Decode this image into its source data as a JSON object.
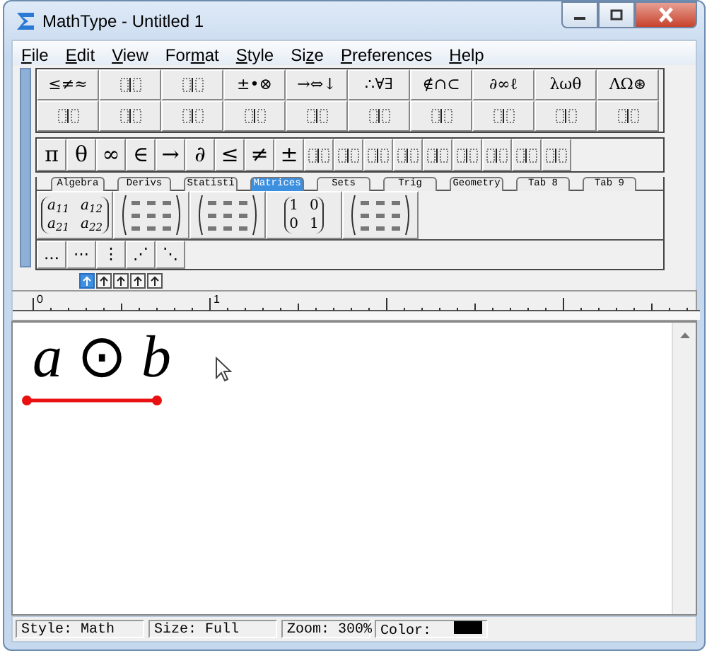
{
  "window": {
    "title": "MathType - Untitled 1"
  },
  "menu": [
    {
      "key": "F",
      "after": "ile"
    },
    {
      "key": "E",
      "after": "dit"
    },
    {
      "key": "V",
      "after": "iew"
    },
    {
      "before": "For",
      "key": "m",
      "after": "at"
    },
    {
      "key": "S",
      "after": "tyle"
    },
    {
      "before": "Si",
      "key": "z",
      "after": "e"
    },
    {
      "key": "P",
      "after": "references"
    },
    {
      "key": "H",
      "after": "elp"
    }
  ],
  "palette_rows": [
    [
      {
        "kind": "symbols",
        "label": "≤≠≈"
      },
      {
        "kind": "template"
      },
      {
        "kind": "template"
      },
      {
        "kind": "symbols",
        "label": "±•⊗"
      },
      {
        "kind": "symbols",
        "label": "→⇔↓"
      },
      {
        "kind": "symbols",
        "label": "∴∀∃"
      },
      {
        "kind": "symbols",
        "label": "∉∩⊂"
      },
      {
        "kind": "symbols",
        "label": "∂∞ℓ"
      },
      {
        "kind": "symbols",
        "label": "λωθ"
      },
      {
        "kind": "symbols",
        "label": "ΛΩ⊛"
      }
    ],
    [
      {
        "kind": "template"
      },
      {
        "kind": "template"
      },
      {
        "kind": "template"
      },
      {
        "kind": "template"
      },
      {
        "kind": "template"
      },
      {
        "kind": "template"
      },
      {
        "kind": "template"
      },
      {
        "kind": "template"
      },
      {
        "kind": "template"
      },
      {
        "kind": "template"
      }
    ]
  ],
  "small_bar": [
    {
      "kind": "symbols",
      "label": "π"
    },
    {
      "kind": "symbols",
      "label": "θ"
    },
    {
      "kind": "symbols",
      "label": "∞"
    },
    {
      "kind": "symbols",
      "label": "∈"
    },
    {
      "kind": "symbols",
      "label": "→"
    },
    {
      "kind": "symbols",
      "label": "∂"
    },
    {
      "kind": "symbols",
      "label": "≤"
    },
    {
      "kind": "symbols",
      "label": "≠"
    },
    {
      "kind": "symbols",
      "label": "±"
    },
    {
      "kind": "template"
    },
    {
      "kind": "template"
    },
    {
      "kind": "template"
    },
    {
      "kind": "template"
    },
    {
      "kind": "template"
    },
    {
      "kind": "template"
    },
    {
      "kind": "template"
    },
    {
      "kind": "template"
    },
    {
      "kind": "template"
    }
  ],
  "tabs": [
    {
      "label": "Algebra",
      "selected": false
    },
    {
      "label": "Derivs",
      "selected": false
    },
    {
      "label": "Statisti",
      "selected": false
    },
    {
      "label": "Matrices",
      "selected": true
    },
    {
      "label": "Sets",
      "selected": false
    },
    {
      "label": "Trig",
      "selected": false
    },
    {
      "label": "Geometry",
      "selected": false
    },
    {
      "label": "Tab 8",
      "selected": false
    },
    {
      "label": "Tab 9",
      "selected": false
    }
  ],
  "tab_items": [
    {
      "kind": "cells",
      "cells": [
        "a$_{11}$",
        "a$_{12}$",
        "a$_{21}$",
        "a$_{22}$"
      ]
    },
    {
      "kind": "matrix"
    },
    {
      "kind": "matrix"
    },
    {
      "kind": "cells",
      "cells": [
        "1",
        "0",
        "0",
        "1"
      ]
    },
    {
      "kind": "matrix"
    }
  ],
  "dots_row": [
    {
      "label": "…"
    },
    {
      "label": "⋯"
    },
    {
      "label": "⋮"
    },
    {
      "label": "⋰"
    },
    {
      "label": "⋱"
    }
  ],
  "nudge_buttons": [
    {
      "selected": true
    },
    {
      "selected": false
    },
    {
      "selected": false
    },
    {
      "selected": false
    },
    {
      "selected": false
    }
  ],
  "ruler": {
    "labels": [
      "0",
      "1"
    ]
  },
  "equation": "*a* ⊙ *b*",
  "status_bar": [
    {
      "label": "Style: Math"
    },
    {
      "label": "Size: Full"
    },
    {
      "label": "Zoom: 300%"
    },
    {
      "label": "Color:",
      "color": "#000000"
    }
  ]
}
